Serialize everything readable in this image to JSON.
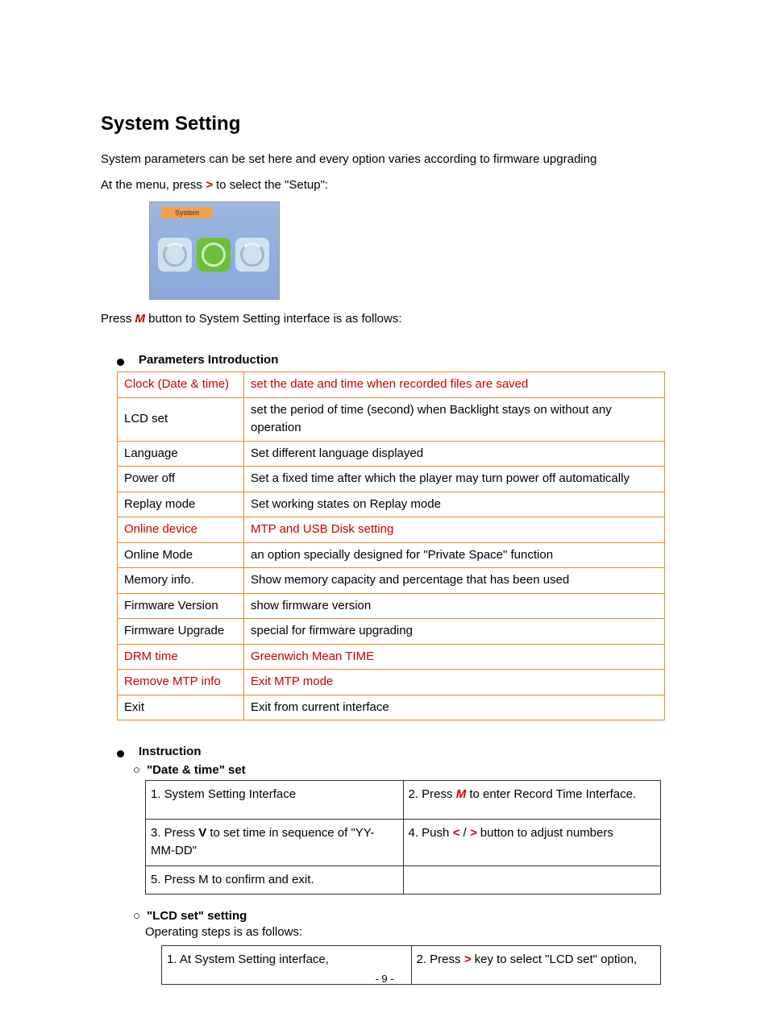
{
  "heading": "System Setting",
  "intro1": "System parameters can be set here and every option varies according to firmware upgrading",
  "intro2_a": "At the menu, press ",
  "intro2_sym": ">",
  "intro2_b": " to select the \"Setup\":",
  "screenshot_tab": "System",
  "intro3_a": "Press ",
  "intro3_m": "M",
  "intro3_b": " button to System Setting interface is as follows:",
  "section_params": "Parameters Introduction",
  "params": [
    {
      "name": "Clock (Date & time)",
      "desc": "set the date and time when recorded files are saved",
      "red": true
    },
    {
      "name": "LCD set",
      "desc": "set the period of time (second) when Backlight stays on without any operation",
      "red": false
    },
    {
      "name": "Language",
      "desc": "Set different language displayed",
      "red": false
    },
    {
      "name": "Power off",
      "desc": "Set a fixed time after which the player may turn power off automatically",
      "red": false
    },
    {
      "name": "Replay mode",
      "desc": "Set working states on Replay mode",
      "red": false
    },
    {
      "name": "Online device",
      "desc": "MTP and USB Disk setting",
      "red": true
    },
    {
      "name": "Online Mode",
      "desc": "an option specially designed for \"Private Space\" function",
      "red": false
    },
    {
      "name": "Memory info.",
      "desc": "Show memory capacity and percentage that has been used",
      "red": false
    },
    {
      "name": "Firmware Version",
      "desc": "show firmware version",
      "red": false
    },
    {
      "name": "Firmware Upgrade",
      "desc": "special for firmware upgrading",
      "red": false
    },
    {
      "name": "DRM time",
      "desc": "Greenwich Mean TIME",
      "red": true
    },
    {
      "name": "Remove MTP info",
      "desc": "Exit MTP mode",
      "red": true
    },
    {
      "name": "Exit",
      "desc": "Exit from current interface",
      "red": false
    }
  ],
  "section_instruction": "Instruction",
  "sub1": "\"Date & time\" set",
  "dt_steps": {
    "1": "1. System Setting Interface",
    "2_a": "2. Press ",
    "2_m": "M",
    "2_b": " to enter Record Time Interface.",
    "3_a": "3. Press ",
    "3_v": "V",
    "3_b": " to set time in sequence of \"YY-MM-DD\"",
    "4_a": "4. Push ",
    "4_sym": "<",
    "4_mid": " / ",
    "4_sym2": ">",
    "4_b": " button to adjust numbers",
    "5": "5. Press M to confirm and exit."
  },
  "sub2": "\"LCD set\" setting",
  "lcd_intro": "Operating steps is as follows:",
  "lcd_steps": {
    "1": "1.  At System Setting interface,",
    "2_a": "2. Press ",
    "2_sym": ">",
    "2_b": " key to select \"LCD set\" option,"
  },
  "page_number": "- 9 -"
}
